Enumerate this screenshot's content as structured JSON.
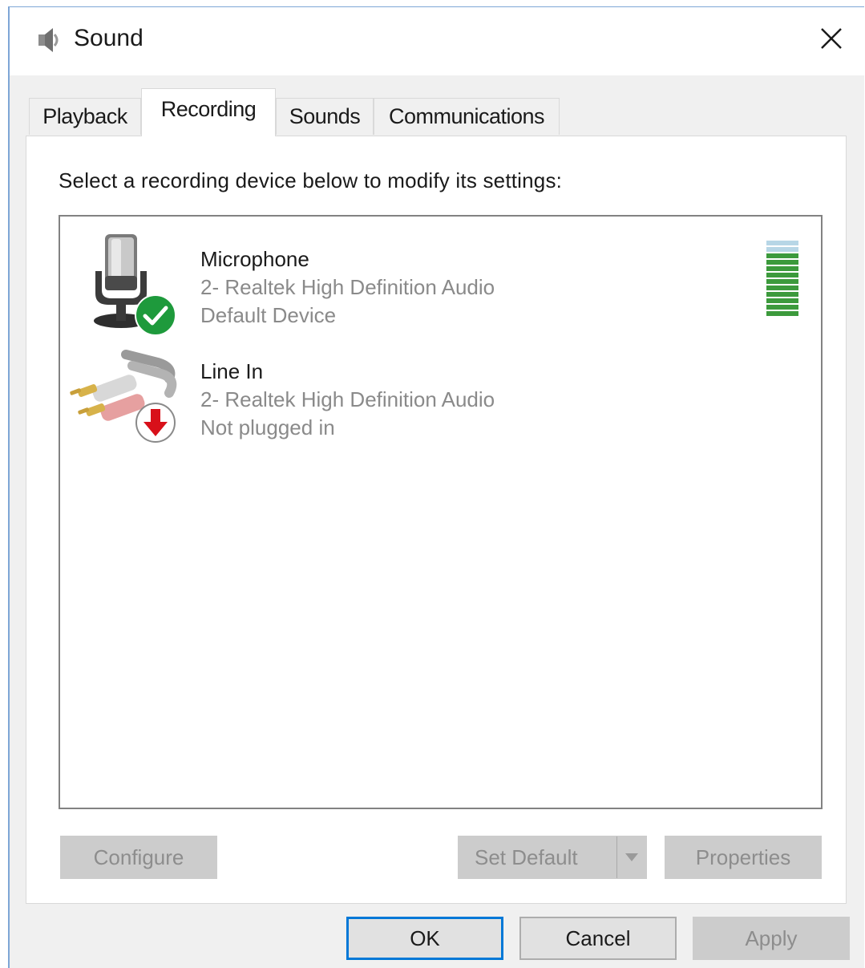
{
  "window": {
    "title": "Sound",
    "icon": "speaker-icon",
    "close_icon": "close-icon"
  },
  "tabs": [
    {
      "label": "Playback",
      "active": false
    },
    {
      "label": "Recording",
      "active": true
    },
    {
      "label": "Sounds",
      "active": false
    },
    {
      "label": "Communications",
      "active": false
    }
  ],
  "recording": {
    "instruction": "Select a recording device below to modify its settings:",
    "devices": [
      {
        "name": "Microphone",
        "driver": "2- Realtek High Definition Audio",
        "status": "Default Device",
        "icon": "microphone-icon",
        "badge": "default-check-icon",
        "level_segments_active": 10,
        "level_segments_total": 12
      },
      {
        "name": "Line In",
        "driver": "2- Realtek High Definition Audio",
        "status": "Not plugged in",
        "icon": "rca-cable-icon",
        "badge": "unplugged-arrow-icon"
      }
    ],
    "buttons": {
      "configure": "Configure",
      "set_default": "Set Default",
      "properties": "Properties"
    }
  },
  "footer": {
    "ok": "OK",
    "cancel": "Cancel",
    "apply": "Apply"
  },
  "colors": {
    "accent": "#0078d7",
    "level_green": "#3c9a3c",
    "level_inactive": "#b7d6e6",
    "disabled_text": "#8d8d8d"
  }
}
